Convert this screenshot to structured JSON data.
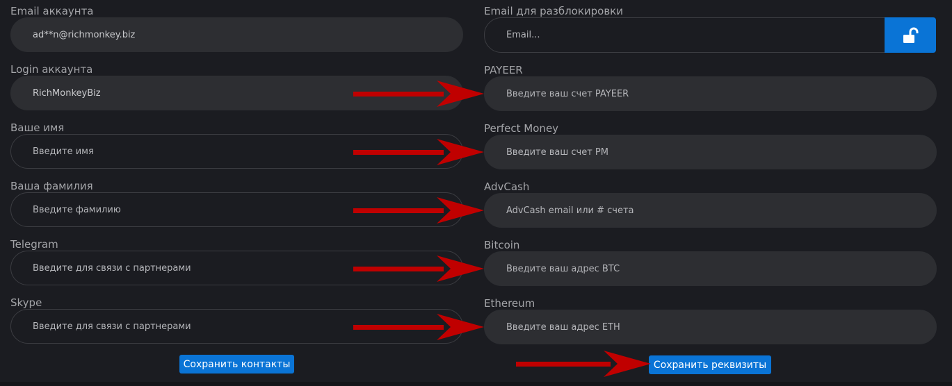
{
  "left": {
    "email": {
      "label": "Email аккаунта",
      "value": "ad**n@richmonkey.biz"
    },
    "login": {
      "label": "Login аккаунта",
      "value": "RichMonkeyBiz"
    },
    "first_name": {
      "label": "Ваше имя",
      "placeholder": "Введите имя"
    },
    "last_name": {
      "label": "Ваша фамилия",
      "placeholder": "Введите фамилию"
    },
    "telegram": {
      "label": "Telegram",
      "placeholder": "Введите для связи с партнерами"
    },
    "skype": {
      "label": "Skype",
      "placeholder": "Введите для связи с партнерами"
    },
    "save_label": "Сохранить контакты"
  },
  "right": {
    "unlock_email": {
      "label": "Email для разблокировки",
      "placeholder": "Email..."
    },
    "payeer": {
      "label": "PAYEER",
      "placeholder": "Введите ваш счет PAYEER"
    },
    "perfect_money": {
      "label": "Perfect Money",
      "placeholder": "Введите ваш счет PM"
    },
    "advcash": {
      "label": "AdvCash",
      "placeholder": "AdvCash email или # счета"
    },
    "bitcoin": {
      "label": "Bitcoin",
      "placeholder": "Введите ваш адрес BTC"
    },
    "ethereum": {
      "label": "Ethereum",
      "placeholder": "Введите ваш адрес ETH"
    },
    "save_label": "Сохранить реквизиты"
  },
  "colors": {
    "background": "#1b1c21",
    "field_filled": "#2d2e32",
    "accent": "#0a74d6",
    "annotation_arrow": "#c00000"
  },
  "icons": {
    "unlock": "unlock-icon",
    "arrow": "arrow-right-icon"
  }
}
